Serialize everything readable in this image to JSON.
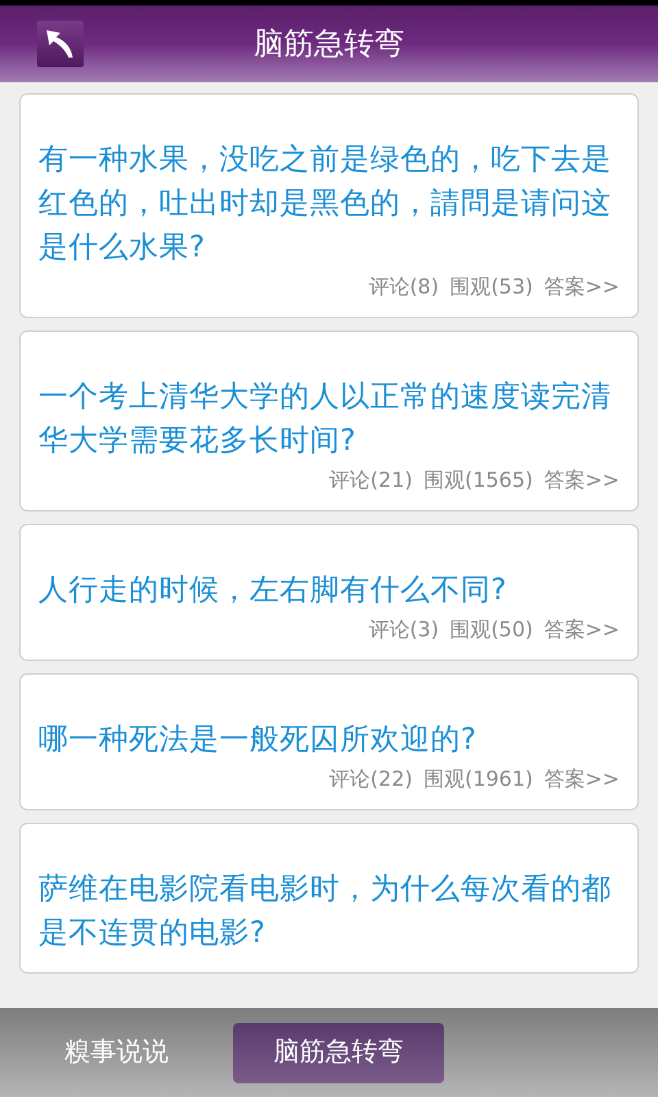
{
  "header": {
    "title": "脑筋急转弯"
  },
  "questions": [
    {
      "text": "有一种水果，没吃之前是绿色的，吃下去是红色的，吐出时却是黑色的，請問是请问这是什么水果?",
      "comments": "评论(8)",
      "views": "围观(53)",
      "answer": "答案>>"
    },
    {
      "text": "一个考上清华大学的人以正常的速度读完清华大学需要花多长时间?",
      "comments": "评论(21)",
      "views": "围观(1565)",
      "answer": "答案>>"
    },
    {
      "text": "人行走的时候，左右脚有什么不同?",
      "comments": "评论(3)",
      "views": "围观(50)",
      "answer": "答案>>"
    },
    {
      "text": "哪一种死法是一般死囚所欢迎的?",
      "comments": "评论(22)",
      "views": "围观(1961)",
      "answer": "答案>>"
    },
    {
      "text": "萨维在电影院看电影时，为什么每次看的都是不连贯的电影?"
    }
  ],
  "tabs": [
    {
      "label": "糗事说说",
      "selected": false
    },
    {
      "label": "脑筋急转弯",
      "selected": true
    }
  ]
}
